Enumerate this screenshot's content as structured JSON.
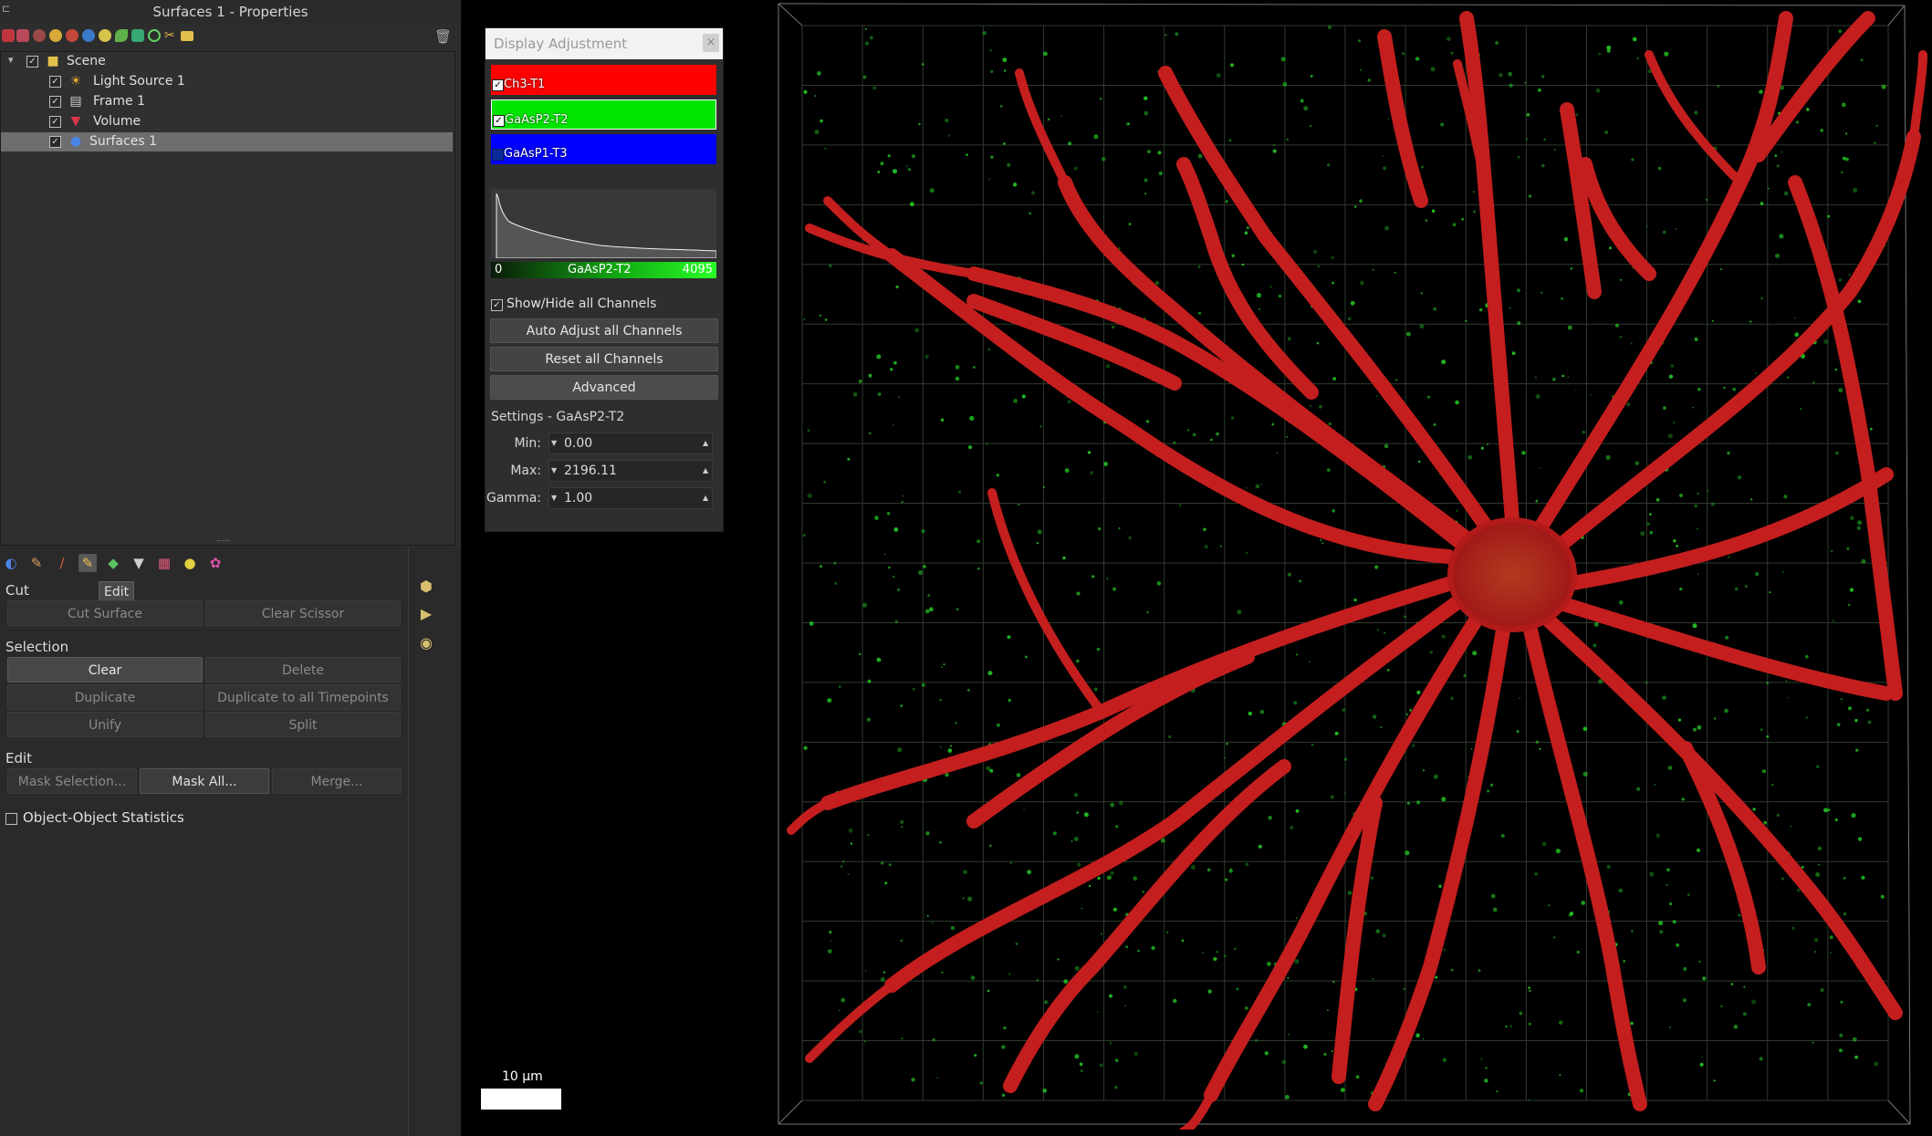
{
  "window": {
    "title": "Surfaces 1 - Properties"
  },
  "toolbar": {
    "icons": [
      "surfaces-icon",
      "rotate-icon",
      "clip-icon",
      "spots-icon",
      "cells-icon",
      "filaments-icon",
      "color-icon",
      "leaf-icon",
      "measure-icon",
      "reference-icon",
      "scissors-icon",
      "folder-icon"
    ],
    "trash_icon": "trash-icon"
  },
  "tree": {
    "items": [
      {
        "label": "Scene",
        "icon": "folder-icon",
        "checked": true
      },
      {
        "label": "Light Source 1",
        "icon": "light-source-icon",
        "checked": true
      },
      {
        "label": "Frame 1",
        "icon": "frame-icon",
        "checked": true
      },
      {
        "label": "Volume",
        "icon": "volume-icon",
        "checked": true
      },
      {
        "label": "Surfaces 1",
        "icon": "surfaces-icon",
        "checked": true,
        "selected": true
      }
    ]
  },
  "tabs": {
    "icons": [
      "creation-icon",
      "settings-icon",
      "edit-icon",
      "tracking-icon",
      "color-icon",
      "filter-icon",
      "statistics-icon",
      "color-wheel-icon",
      "gear-icon"
    ],
    "active_index": 3,
    "tooltip": "Edit"
  },
  "cut": {
    "title": "Cut",
    "cut_surface": "Cut Surface",
    "clear_scissor": "Clear Scissor"
  },
  "selection": {
    "title": "Selection",
    "clear": "Clear",
    "delete": "Delete",
    "duplicate": "Duplicate",
    "duplicate_all": "Duplicate to all Timepoints",
    "unify": "Unify",
    "split": "Split"
  },
  "edit": {
    "title": "Edit",
    "mask_selection": "Mask Selection...",
    "mask_all": "Mask All...",
    "merge": "Merge..."
  },
  "object_stats": {
    "label": "Object-Object Statistics",
    "checked": false
  },
  "display": {
    "title": "Display Adjustment",
    "close": "×",
    "channels": [
      {
        "name": "Ch3-T1",
        "color": "#ff0000",
        "checked": true
      },
      {
        "name": "GaAsP2-T2",
        "color": "#00e600",
        "checked": true
      },
      {
        "name": "GaAsP1-T3",
        "color": "#0000ff",
        "checked": false
      }
    ],
    "histogram": {
      "min_label": "0",
      "channel_label": "GaAsP2-T2",
      "max_label": "4095"
    },
    "show_hide": "Show/Hide all Channels",
    "auto_adjust": "Auto Adjust all Channels",
    "reset": "Reset all Channels",
    "advanced": "Advanced",
    "settings_label": "Settings - GaAsP2-T2",
    "min_label": "Min:",
    "min_value": "0.00",
    "max_label": "Max:",
    "max_value": "2196.11",
    "gamma_label": "Gamma:",
    "gamma_value": "1.00"
  },
  "viewer": {
    "scale_label": "10 µm",
    "surface_color": "#c41e1e",
    "spot_color": "#25c425"
  }
}
